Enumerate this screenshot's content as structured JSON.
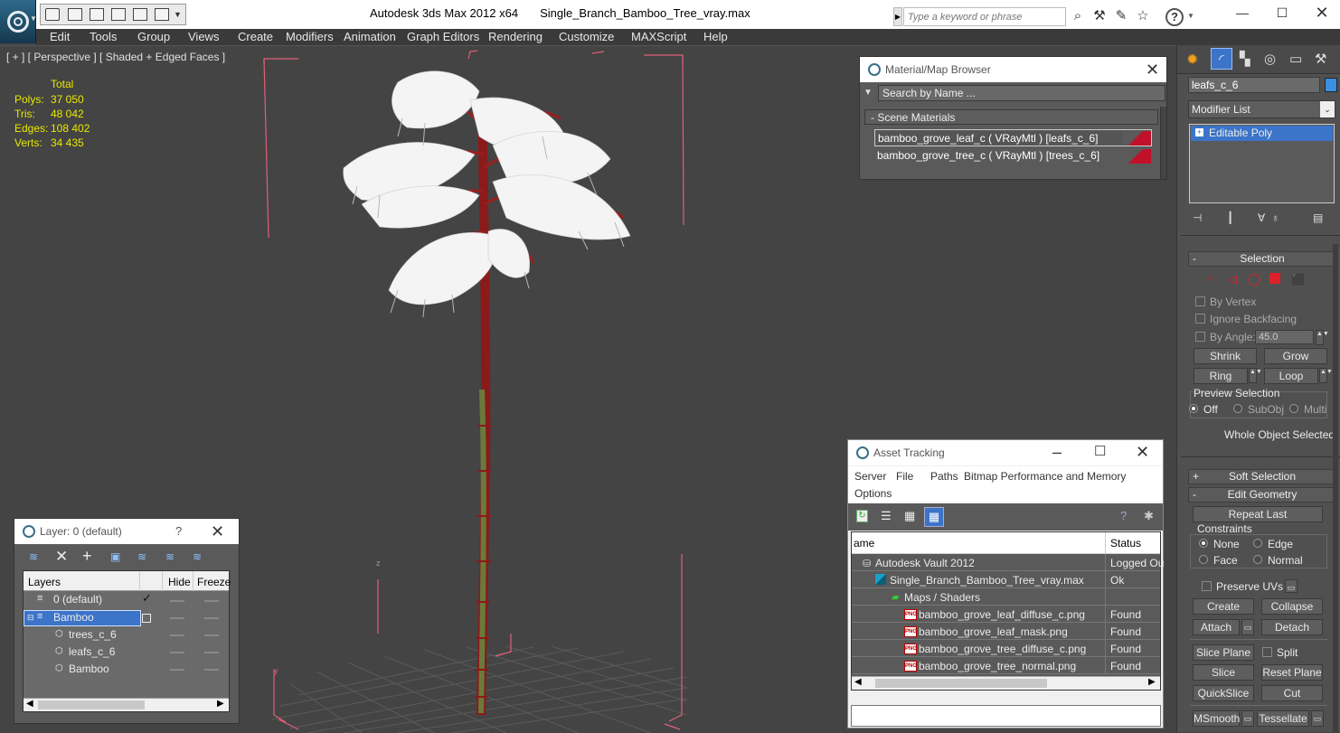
{
  "app_title": "Autodesk 3ds Max  2012 x64",
  "file_title": "Single_Branch_Bamboo_Tree_vray.max",
  "search": {
    "placeholder": "Type a keyword or phrase"
  },
  "menu": [
    "Edit",
    "Tools",
    "Group",
    "Views",
    "Create",
    "Modifiers",
    "Animation",
    "Graph Editors",
    "Rendering",
    "Customize",
    "MAXScript",
    "Help"
  ],
  "viewport": {
    "label": "[ + ] [ Perspective ] [ Shaded + Edged Faces ]",
    "stats_header": "Total",
    "stats": [
      {
        "label": "Polys:",
        "value": "37 050"
      },
      {
        "label": "Tris:",
        "value": "48 042"
      },
      {
        "label": "Edges:",
        "value": "108 402"
      },
      {
        "label": "Verts:",
        "value": "34 435"
      }
    ],
    "axis_z": "z",
    "axis_y": "y"
  },
  "material_browser": {
    "title": "Material/Map Browser",
    "search_placeholder": "Search by Name ...",
    "section": "- Scene Materials",
    "items": [
      "bamboo_grove_leaf_c  ( VRayMtl )  [leafs_c_6]",
      "bamboo_grove_tree_c  ( VRayMtl )  [trees_c_6]"
    ]
  },
  "layer_dialog": {
    "title": "Layer: 0 (default)",
    "help": "?",
    "columns": [
      "Layers",
      "Hide",
      "Freeze"
    ],
    "rows": [
      "0 (default)",
      "Bamboo",
      "trees_c_6",
      "leafs_c_6",
      "Bamboo"
    ]
  },
  "asset_tracking": {
    "title": "Asset Tracking",
    "menu": [
      "Server",
      "File",
      "Paths",
      "Bitmap Performance and Memory",
      "Options"
    ],
    "columns": [
      "ame",
      "Status"
    ],
    "rows": [
      {
        "name": "Autodesk Vault 2012",
        "status": "Logged Ou"
      },
      {
        "name": "Single_Branch_Bamboo_Tree_vray.max",
        "status": "Ok"
      },
      {
        "name": "Maps / Shaders",
        "status": ""
      },
      {
        "name": "bamboo_grove_leaf_diffuse_c.png",
        "status": "Found"
      },
      {
        "name": "bamboo_grove_leaf_mask.png",
        "status": "Found"
      },
      {
        "name": "bamboo_grove_tree_diffuse_c.png",
        "status": "Found"
      },
      {
        "name": "bamboo_grove_tree_normal.png",
        "status": "Found"
      }
    ],
    "png_badge": "PNG"
  },
  "command_panel": {
    "object_name": "leafs_c_6",
    "modifier_list": "Modifier List",
    "stack_item": "Editable Poly",
    "selection": {
      "header": "Selection",
      "by_vertex": "By Vertex",
      "ignore_backfacing": "Ignore Backfacing",
      "by_angle": "By Angle:",
      "angle_value": "45.0",
      "shrink": "Shrink",
      "grow": "Grow",
      "ring": "Ring",
      "loop": "Loop",
      "preview_selection": "Preview Selection",
      "preview_options": [
        "Off",
        "SubObj",
        "Multi"
      ],
      "status": "Whole Object Selected"
    },
    "soft_selection": "Soft Selection",
    "edit_geometry": {
      "header": "Edit Geometry",
      "repeat_last": "Repeat Last",
      "constraints": "Constraints",
      "constraint_options": [
        "None",
        "Edge",
        "Face",
        "Normal"
      ],
      "preserve_uvs": "Preserve UVs",
      "create": "Create",
      "collapse": "Collapse",
      "attach": "Attach",
      "detach": "Detach",
      "slice_plane": "Slice Plane",
      "split": "Split",
      "slice": "Slice",
      "reset_plane": "Reset Plane",
      "quickslice": "QuickSlice",
      "cut": "Cut",
      "msmooth": "MSmooth",
      "tessellate": "Tessellate"
    }
  },
  "colors": {
    "viewport_bg": "#444444",
    "selection_box": "#e0607a",
    "trunk": "#8b1a1a",
    "stalk_green": "#6b7a3a",
    "stats_text": "#e8e800",
    "stack_highlight": "#3b74c8"
  }
}
